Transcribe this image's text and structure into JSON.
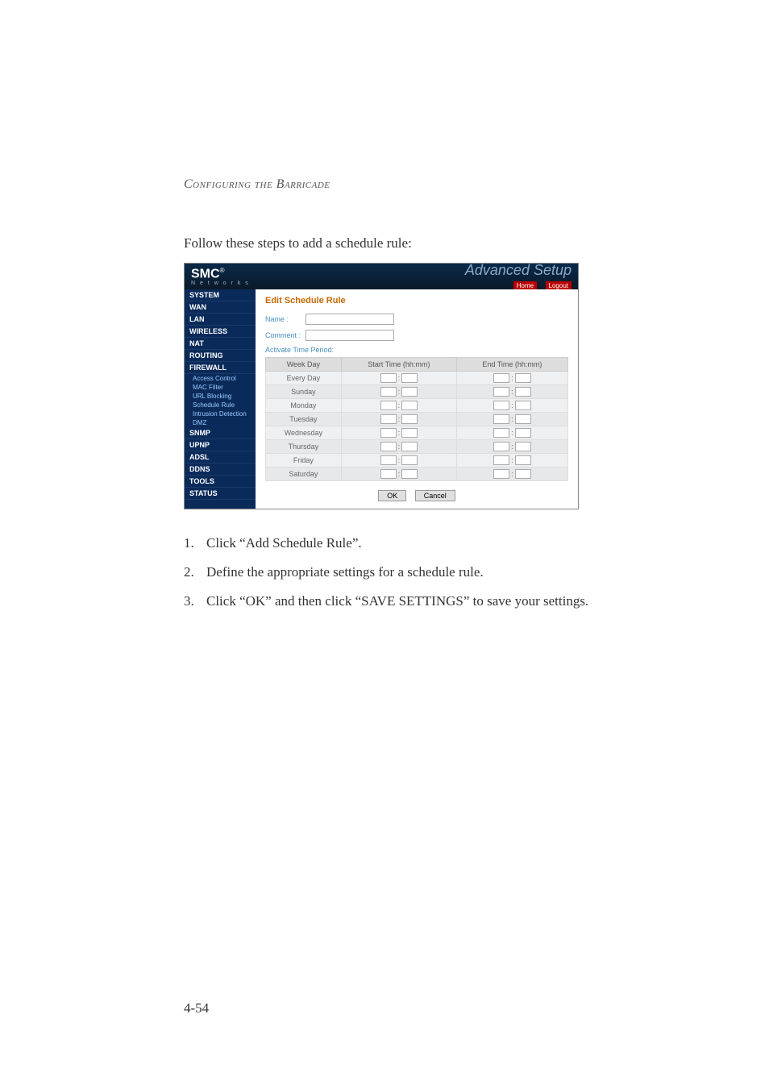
{
  "running_header": "Configuring the Barricade",
  "intro": "Follow these steps to add a schedule rule:",
  "screenshot": {
    "logo": "SMC",
    "logo_sub": "N e t w o r k s",
    "brand": "Advanced Setup",
    "toplink_home": "Home",
    "toplink_logout": "Logout",
    "sidebar": {
      "items": [
        "SYSTEM",
        "WAN",
        "LAN",
        "WIRELESS",
        "NAT",
        "ROUTING",
        "FIREWALL"
      ],
      "subs": [
        "Access Control",
        "MAC Filter",
        "URL Blocking",
        "Schedule Rule",
        "Intrusion Detection",
        "DMZ"
      ],
      "items2": [
        "SNMP",
        "UPnP",
        "ADSL",
        "DDNS",
        "TOOLS",
        "STATUS"
      ]
    },
    "form": {
      "title": "Edit Schedule Rule",
      "name_label": "Name :",
      "name_value": "",
      "comment_label": "Comment :",
      "comment_value": "",
      "activate_label": "Activate Time Period:"
    },
    "table": {
      "headers": [
        "Week Day",
        "Start Time (hh:mm)",
        "End Time (hh:mm)"
      ],
      "days": [
        "Every Day",
        "Sunday",
        "Monday",
        "Tuesday",
        "Wednesday",
        "Thursday",
        "Friday",
        "Saturday"
      ]
    },
    "buttons": {
      "ok": "OK",
      "cancel": "Cancel"
    }
  },
  "steps": [
    "Click “Add Schedule Rule”.",
    "Define the appropriate settings for a schedule rule.",
    "Click “OK” and then click “SAVE SETTINGS” to save your settings."
  ],
  "page_number": "4-54"
}
